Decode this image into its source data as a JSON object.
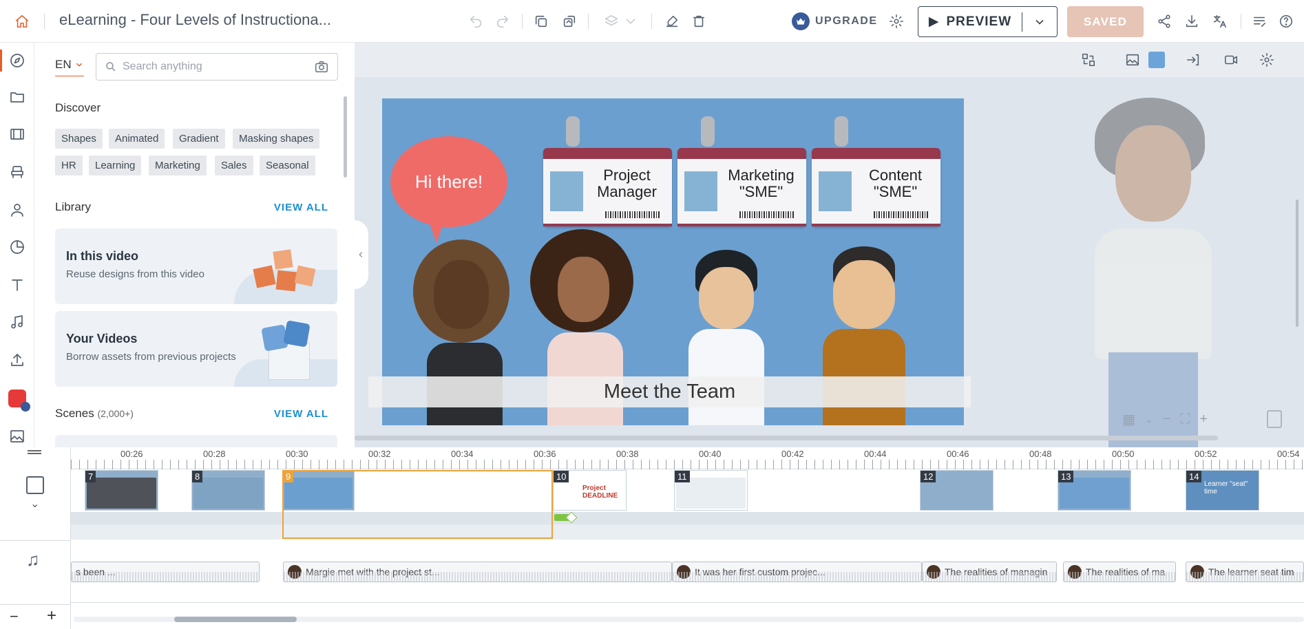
{
  "app": {
    "title": "eLearning - Four Levels of Instructiona...",
    "upgrade_label": "UPGRADE",
    "preview_label": "PREVIEW",
    "saved_label": "SAVED",
    "accent": "#e85d28"
  },
  "panel": {
    "language": "EN",
    "search_placeholder": "Search anything",
    "discover_title": "Discover",
    "chips": [
      "Shapes",
      "Animated",
      "Gradient",
      "Masking shapes",
      "HR",
      "Learning",
      "Marketing",
      "Sales",
      "Seasonal"
    ],
    "library_title": "Library",
    "view_all": "VIEW ALL",
    "cards": [
      {
        "title": "In this video",
        "subtitle": "Reuse designs from this video"
      },
      {
        "title": "Your Videos",
        "subtitle": "Borrow assets from previous projects"
      }
    ],
    "scenes_title": "Scenes",
    "scenes_count": "(2,000+)"
  },
  "canvas": {
    "bubble_text": "Hi there!",
    "badges": [
      {
        "line1": "Project",
        "line2": "Manager"
      },
      {
        "line1": "Marketing",
        "line2": "\"SME\""
      },
      {
        "line1": "Content",
        "line2": "\"SME\""
      }
    ],
    "caption": "Meet the Team"
  },
  "timeline": {
    "ticks": [
      "00:26",
      "00:28",
      "00:30",
      "00:32",
      "00:34",
      "00:36",
      "00:38",
      "00:40",
      "00:42",
      "00:44",
      "00:46",
      "00:48",
      "00:50",
      "00:52",
      "00:54"
    ],
    "scenes": [
      {
        "num": "7"
      },
      {
        "num": "8"
      },
      {
        "num": "9"
      },
      {
        "num": "10",
        "label": "Project DEADLINE"
      },
      {
        "num": "11"
      },
      {
        "num": "12"
      },
      {
        "num": "13"
      },
      {
        "num": "14",
        "label": "Learner \"seat\" time"
      }
    ],
    "audio": [
      "s been ...",
      "Margie met with the project st...",
      "It was her first custom projec...",
      "The realities of managin",
      "The realities of ma",
      "The learner seat tim"
    ],
    "zoom_out": "−",
    "zoom_in": "+"
  }
}
